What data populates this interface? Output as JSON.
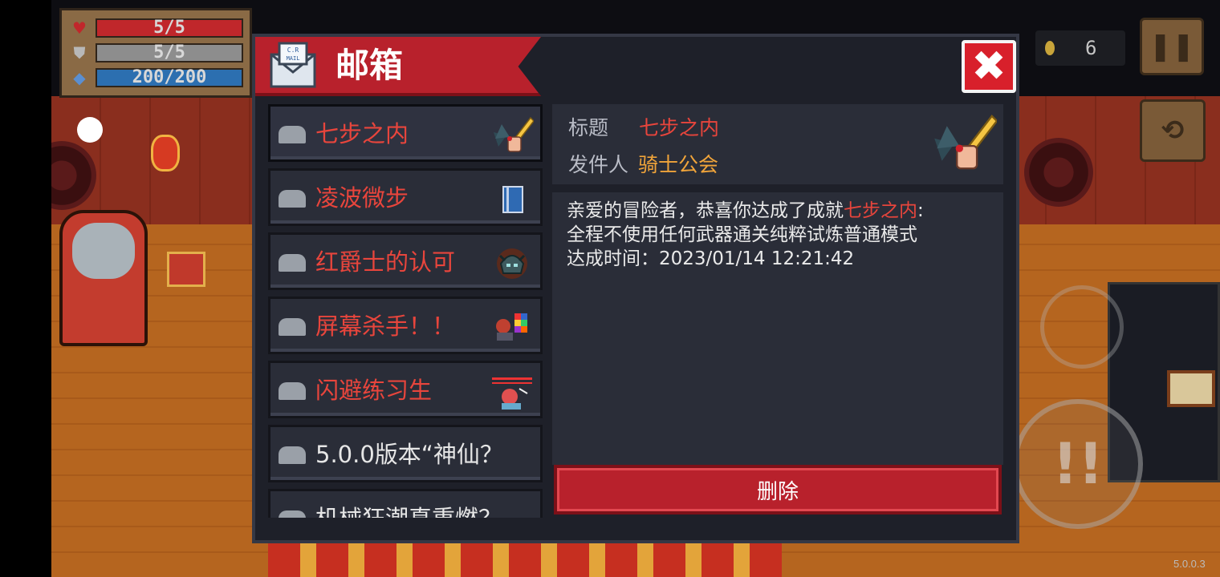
{
  "hud": {
    "hp": {
      "icon": "heart-icon",
      "text": "5/5",
      "fraction": 1.0,
      "color": "#c0272b"
    },
    "armor": {
      "icon": "shield-icon",
      "text": "5/5",
      "fraction": 1.0,
      "color": "#8d8d8d"
    },
    "energy": {
      "icon": "diamond-icon",
      "text": "200/200",
      "fraction": 1.0,
      "color": "#2c6fb0"
    },
    "coins": "6",
    "version": "5.0.0.3"
  },
  "mailbox": {
    "title": "邮箱",
    "icon_text": "C.R\nMAIL",
    "close_label": "✖",
    "items": [
      {
        "label": "七步之内",
        "color": "#e8453c",
        "icon": "sword-icon"
      },
      {
        "label": "凌波微步",
        "color": "#e8453c",
        "icon": "book-icon"
      },
      {
        "label": "红爵士的认可",
        "color": "#e8453c",
        "icon": "helmet-icon"
      },
      {
        "label": "屏幕杀手！！",
        "color": "#e8453c",
        "icon": "pixel-character-icon"
      },
      {
        "label": "闪避练习生",
        "color": "#e8453c",
        "icon": "dodge-character-icon"
      },
      {
        "label": "5.0.0版本“神仙？",
        "color": "#e6e6e6",
        "icon": ""
      },
      {
        "label": "机械狂潮真重燃？",
        "color": "#e6e6e6",
        "icon": ""
      }
    ],
    "detail": {
      "title_key": "标题",
      "title_value": "七步之内",
      "sender_key": "发件人",
      "sender_value": "骑士公会",
      "body": {
        "line1_prefix": "亲爱的冒险者，恭喜你达成了成就",
        "line1_highlight": "七步之内",
        "line1_suffix": ":",
        "line2": "全程不使用任何武器通关纯粹试炼普通模式",
        "line3": "达成时间：2023/01/14 12:21:42"
      },
      "delete_label": "删除"
    }
  }
}
